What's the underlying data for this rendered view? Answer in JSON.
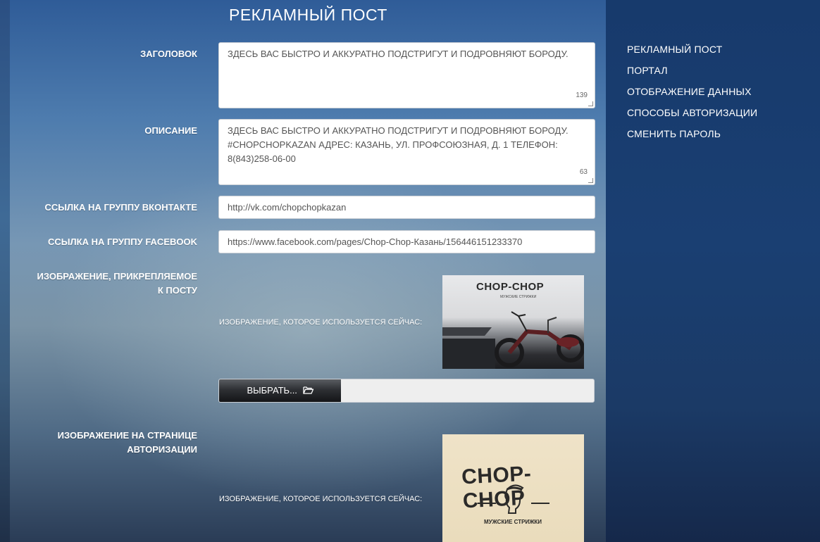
{
  "page_title": "РЕКЛАМНЫЙ ПОСТ",
  "form": {
    "title_label": "ЗАГОЛОВОК",
    "title_value": "ЗДЕСЬ ВАС БЫСТРО И АККУРАТНО ПОДСТРИГУТ И ПОДРОВНЯЮТ БОРОДУ.",
    "title_counter": "139",
    "description_label": "ОПИСАНИЕ",
    "description_value": "ЗДЕСЬ ВАС БЫСТРО И АККУРАТНО ПОДСТРИГУТ И ПОДРОВНЯЮТ БОРОДУ. #CHOPCHOPKAZAN АДРЕС: КАЗАНЬ, УЛ. ПРОФСОЮЗНАЯ, Д. 1 ТЕЛЕФОН: 8(843)258-06-00",
    "description_counter": "63",
    "vk_label": "ССЫЛКА НА ГРУППУ ВКОНТАКТЕ",
    "vk_value": "http://vk.com/chopchopkazan",
    "fb_label": "ССЫЛКА НА ГРУППУ FACEBOOK",
    "fb_value": "https://www.facebook.com/pages/Chop-Chop-Казань/156446151233370",
    "post_image_label_line1": "ИЗОБРАЖЕНИЕ, ПРИКРЕПЛЯЕМОЕ",
    "post_image_label_line2": "К ПОСТУ",
    "current_image_label": "ИЗОБРАЖЕНИЕ, КОТОРОЕ ИСПОЛЬЗУЕТСЯ СЕЙЧАС:",
    "choose_button": "ВЫБРАТЬ...",
    "auth_image_label_line1": "ИЗОБРАЖЕНИЕ НА СТРАНИЦЕ",
    "auth_image_label_line2": "АВТОРИЗАЦИИ",
    "current_image_label_2": "ИЗОБРАЖЕНИЕ, КОТОРОЕ ИСПОЛЬЗУЕТСЯ СЕЙЧАС:"
  },
  "images": {
    "post_logo": "CHOP-CHOP",
    "post_logo_sub": "МУЖСКИЕ СТРИЖКИ",
    "auth_logo": "CHOP-CHOP",
    "auth_logo_sub": "МУЖСКИЕ СТРИЖКИ"
  },
  "sidebar": {
    "items": [
      {
        "label": "РЕКЛАМНЫЙ ПОСТ"
      },
      {
        "label": "ПОРТАЛ"
      },
      {
        "label": "ОТОБРАЖЕНИЕ ДАННЫХ"
      },
      {
        "label": "СПОСОБЫ АВТОРИЗАЦИИ"
      },
      {
        "label": "СМЕНИТЬ ПАРОЛЬ"
      }
    ]
  },
  "icons": {
    "folder": "folder-open-icon"
  }
}
